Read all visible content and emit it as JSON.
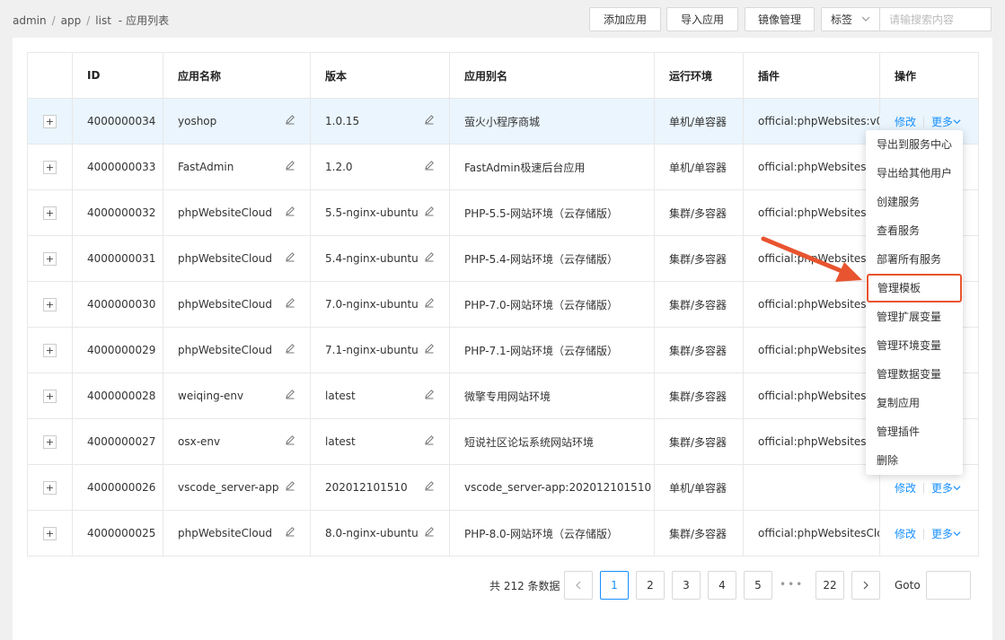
{
  "breadcrumb": {
    "items": [
      "admin",
      "app",
      "list"
    ],
    "title": "应用列表",
    "title_sep": "-"
  },
  "toolbar": {
    "add_label": "添加应用",
    "import_label": "导入应用",
    "image_label": "镜像管理",
    "tag_label": "标签",
    "search_placeholder": "请输搜索内容"
  },
  "table": {
    "headers": [
      "ID",
      "应用名称",
      "版本",
      "应用别名",
      "运行环境",
      "插件",
      "操作"
    ],
    "rows": [
      {
        "id": "4000000034",
        "name": "yoshop",
        "version": "1.0.15",
        "alias": "萤火小程序商城",
        "env": "单机/单容器",
        "plugin": "official:phpWebsites:v0_",
        "ops": true,
        "highlight": true
      },
      {
        "id": "4000000033",
        "name": "FastAdmin",
        "version": "1.2.0",
        "alias": "FastAdmin极速后台应用",
        "env": "单机/单容器",
        "plugin": "official:phpWebsites:v",
        "ops": false
      },
      {
        "id": "4000000032",
        "name": "phpWebsiteCloud",
        "version": "5.5-nginx-ubuntu",
        "alias": "PHP-5.5-网站环境（云存储版）",
        "env": "集群/多容器",
        "plugin": "official:phpWebsitesC",
        "ops": false
      },
      {
        "id": "4000000031",
        "name": "phpWebsiteCloud",
        "version": "5.4-nginx-ubuntu",
        "alias": "PHP-5.4-网站环境（云存储版）",
        "env": "集群/多容器",
        "plugin": "official:phpWebsitesC",
        "ops": false
      },
      {
        "id": "4000000030",
        "name": "phpWebsiteCloud",
        "version": "7.0-nginx-ubuntu",
        "alias": "PHP-7.0-网站环境（云存储版）",
        "env": "集群/多容器",
        "plugin": "official:phpWebsitesC",
        "ops": false
      },
      {
        "id": "4000000029",
        "name": "phpWebsiteCloud",
        "version": "7.1-nginx-ubuntu",
        "alias": "PHP-7.1-网站环境（云存储版）",
        "env": "集群/多容器",
        "plugin": "official:phpWebsitesC",
        "ops": false
      },
      {
        "id": "4000000028",
        "name": "weiqing-env",
        "version": "latest",
        "alias": "微擎专用网站环境",
        "env": "集群/多容器",
        "plugin": "official:phpWebsites:v",
        "ops": false
      },
      {
        "id": "4000000027",
        "name": "osx-env",
        "version": "latest",
        "alias": "短说社区论坛系统网站环境",
        "env": "集群/多容器",
        "plugin": "official:phpWebsites:v",
        "ops": false
      },
      {
        "id": "4000000026",
        "name": "vscode_server-app",
        "version": "202012101510",
        "alias": "vscode_server-app:202012101510",
        "env": "单机/单容器",
        "plugin": "",
        "ops": true
      },
      {
        "id": "4000000025",
        "name": "phpWebsiteCloud",
        "version": "8.0-nginx-ubuntu",
        "alias": "PHP-8.0-网站环境（云存储版）",
        "env": "集群/多容器",
        "plugin": "official:phpWebsitesClo",
        "ops": true
      }
    ],
    "edit_label": "修改",
    "more_label": "更多"
  },
  "dropdown": {
    "items": [
      "导出到服务中心",
      "导出给其他用户",
      "创建服务",
      "查看服务",
      "部署所有服务",
      "管理模板",
      "管理扩展变量",
      "管理环境变量",
      "管理数据变量",
      "复制应用",
      "管理插件",
      "删除"
    ],
    "highlighted_index": 5,
    "highlight_color": "#e8542f"
  },
  "pagination": {
    "total_text": "共 212 条数据",
    "pages": [
      "1",
      "2",
      "3",
      "4",
      "5"
    ],
    "ellipsis": "•••",
    "last_page": "22",
    "current": "1",
    "goto_label": "Goto"
  },
  "colors": {
    "accent": "#1890ff",
    "annotation": "#e8542f",
    "row_highlight": "#eaf5fd"
  }
}
